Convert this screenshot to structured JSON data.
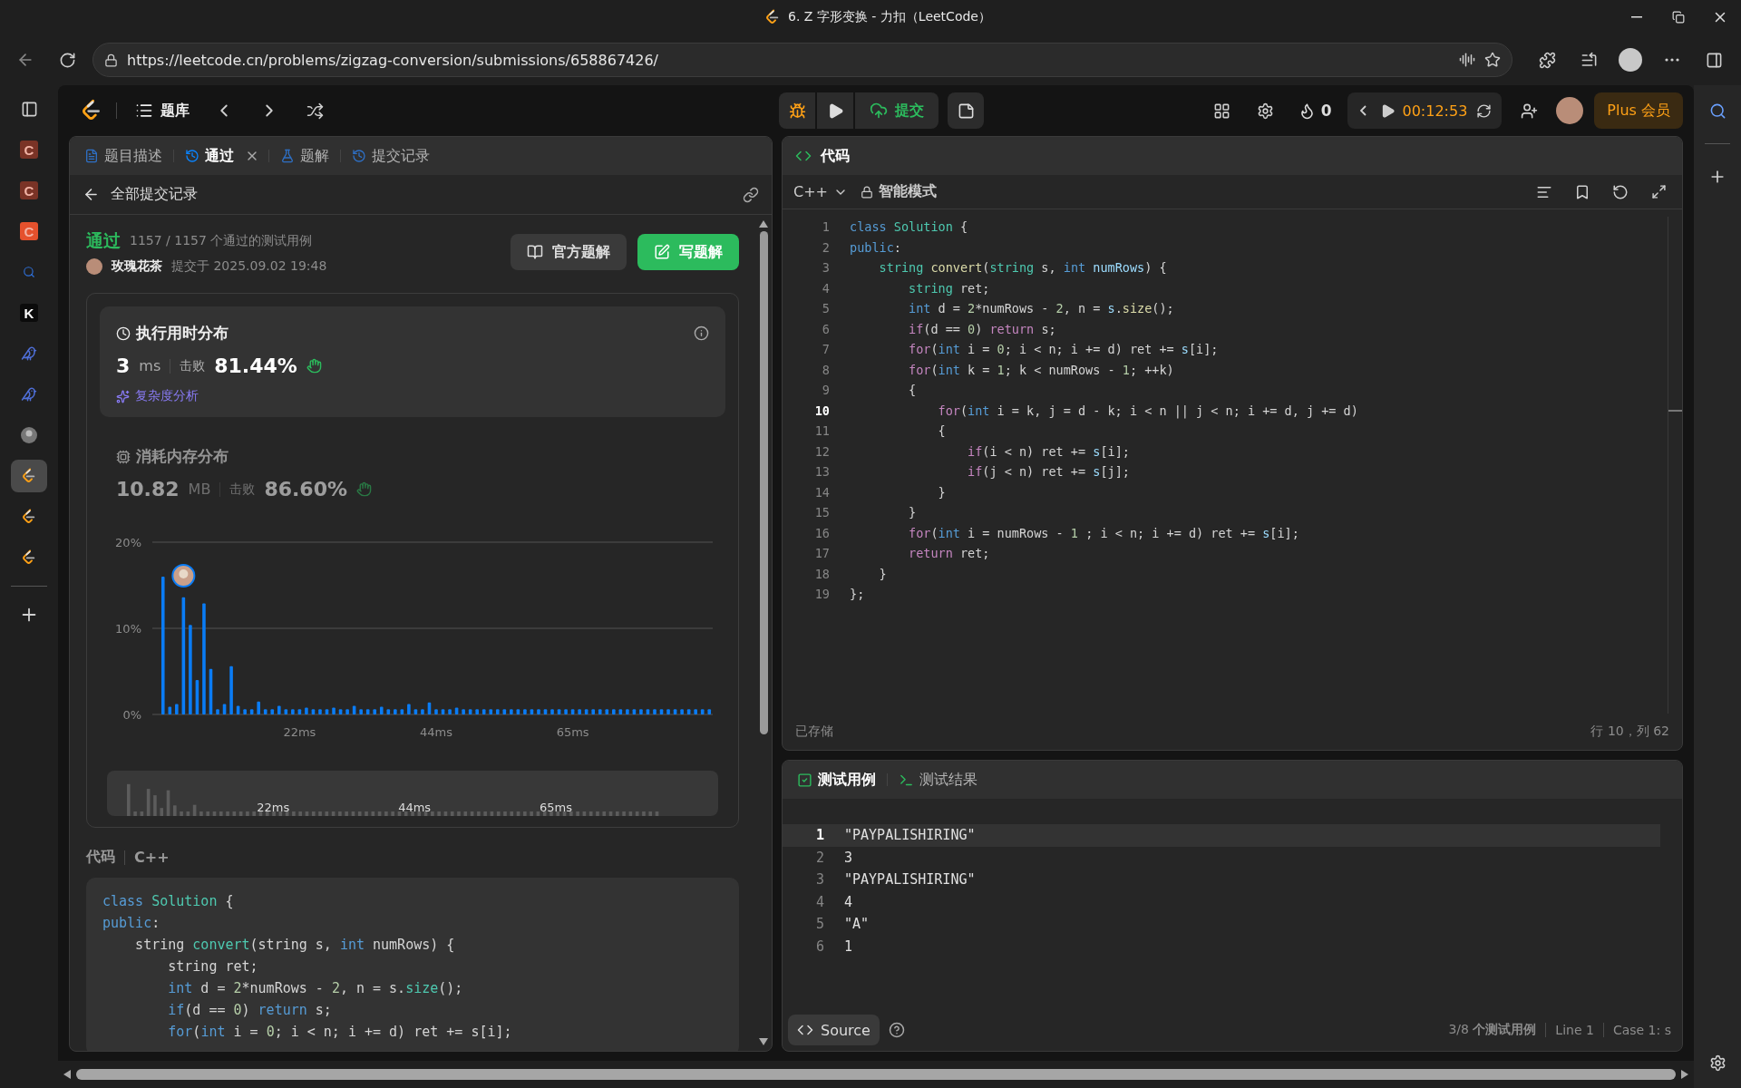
{
  "browser": {
    "title": "6. Z 字形变换 - 力扣（LeetCode）",
    "url": "https://leetcode.cn/problems/zigzag-conversion/submissions/658867426/"
  },
  "sidebar_tabs": [
    {
      "kind": "letter",
      "label": "C",
      "color": "#7a3326",
      "selected": false
    },
    {
      "kind": "letter",
      "label": "C",
      "color": "#7a3326",
      "selected": false
    },
    {
      "kind": "letter",
      "label": "C",
      "color": "#e5512d",
      "selected": false
    },
    {
      "kind": "search",
      "selected": false
    },
    {
      "kind": "letter",
      "label": "K",
      "color": "#0b0b0b",
      "selected": false
    },
    {
      "kind": "bird",
      "selected": false
    },
    {
      "kind": "bird",
      "selected": false
    },
    {
      "kind": "avatar",
      "selected": false
    },
    {
      "kind": "leetcode",
      "selected": true
    },
    {
      "kind": "leetcode",
      "selected": false
    },
    {
      "kind": "leetcode",
      "selected": false
    }
  ],
  "nav": {
    "library": "题库",
    "submit": "提交",
    "streak": "0",
    "timer": "00:12:53",
    "plus": "Plus 会员"
  },
  "left_tabs": [
    {
      "label": "题目描述",
      "kind": "description",
      "selected": false,
      "closable": false
    },
    {
      "label": "通过",
      "kind": "result",
      "selected": true,
      "closable": true
    },
    {
      "label": "题解",
      "kind": "solutions",
      "selected": false,
      "closable": false
    },
    {
      "label": "提交记录",
      "kind": "submissions",
      "selected": false,
      "closable": false
    }
  ],
  "submission": {
    "back": "全部提交记录",
    "status": "通过",
    "cases": "1157 / 1157 个通过的测试用例",
    "user": "玫瑰花茶",
    "submitted": "提交于 2025.09.02 19:48",
    "buttons": [
      {
        "kind": "solution",
        "label": "官方题解"
      },
      {
        "kind": "write",
        "label": "写题解"
      }
    ]
  },
  "stats": [
    {
      "kind": "time",
      "title": "执行用时分布",
      "value": "3",
      "unit": "ms",
      "beat_label": "击败",
      "beat": "81.44%",
      "selected": true,
      "link": "复杂度分析",
      "chart_data": {
        "type": "bar",
        "ylim": [
          0,
          20
        ],
        "yticks": [
          {
            "value": 0,
            "label": "0%"
          },
          {
            "value": 10,
            "label": "10%"
          },
          {
            "value": 20,
            "label": "20%"
          }
        ],
        "categories": [
          null,
          null,
          null,
          null,
          null,
          null,
          null,
          null,
          null,
          null,
          null,
          null,
          null,
          null,
          null,
          null,
          null,
          null,
          null,
          null,
          "22ms",
          null,
          null,
          null,
          null,
          null,
          null,
          null,
          null,
          null,
          null,
          null,
          null,
          null,
          null,
          null,
          null,
          null,
          null,
          null,
          "44ms",
          null,
          null,
          null,
          null,
          null,
          null,
          null,
          null,
          null,
          null,
          null,
          null,
          null,
          null,
          null,
          null,
          null,
          null,
          null,
          "65ms",
          null,
          null,
          null,
          null,
          null,
          null,
          null,
          null,
          null,
          null,
          null,
          null,
          null,
          null,
          null,
          null,
          null,
          null,
          null,
          null
        ],
        "series": [
          {
            "color": "#0a7cf5",
            "values": [
              16.0,
              0.9,
              1.2,
              13.6,
              10.4,
              4.0,
              12.9,
              5.3,
              0.6,
              1.2,
              5.6,
              1.0,
              0.6,
              0.6,
              1.5,
              0.6,
              0.6,
              1.0,
              0.6,
              0.6,
              0.6,
              0.8,
              0.6,
              0.6,
              0.6,
              0.8,
              0.6,
              0.6,
              1.0,
              0.6,
              0.6,
              0.6,
              0.9,
              0.6,
              0.6,
              0.6,
              1.2,
              0.6,
              0.6,
              1.4,
              0.6,
              0.6,
              0.6,
              0.8,
              0.6,
              0.6,
              0.6,
              0.6,
              0.6,
              0.6,
              0.6,
              0.6,
              0.6,
              0.6,
              0.6,
              0.6,
              0.6,
              0.6,
              0.6,
              0.6,
              0.6,
              0.6,
              0.6,
              0.6,
              0.6,
              0.6,
              0.6,
              0.6,
              0.6,
              0.6,
              0.6,
              0.6,
              0.6,
              0.6,
              0.6,
              0.6,
              0.6,
              0.6,
              0.6,
              0.6,
              0.6
            ]
          }
        ]
      },
      "overview_labels": [
        "22ms",
        "44ms",
        "65ms"
      ]
    },
    {
      "kind": "memory",
      "title": "消耗内存分布",
      "value": "10.82",
      "unit": "MB",
      "beat_label": "击败",
      "beat": "86.60%",
      "selected": false
    }
  ],
  "code_section": {
    "title": "代码",
    "language": "C++",
    "lines": [
      {
        "segments": [
          {
            "kind": "keyword",
            "text": "class "
          },
          {
            "kind": "type",
            "text": "Solution"
          },
          {
            "kind": "plain",
            "text": " {"
          }
        ]
      },
      {
        "segments": [
          {
            "kind": "keyword",
            "text": "public"
          },
          {
            "kind": "plain",
            "text": ":"
          }
        ]
      },
      {
        "segments": [
          {
            "kind": "plain",
            "text": "    string "
          },
          {
            "kind": "type",
            "text": "convert"
          },
          {
            "kind": "plain",
            "text": "(string s, "
          },
          {
            "kind": "keyword",
            "text": "int"
          },
          {
            "kind": "plain",
            "text": " numRows) {"
          }
        ]
      },
      {
        "segments": [
          {
            "kind": "plain",
            "text": "        string ret;"
          }
        ]
      },
      {
        "segments": [
          {
            "kind": "keyword",
            "text": "        int"
          },
          {
            "kind": "plain",
            "text": " d = "
          },
          {
            "kind": "number",
            "text": "2"
          },
          {
            "kind": "plain",
            "text": "*numRows - "
          },
          {
            "kind": "number",
            "text": "2"
          },
          {
            "kind": "plain",
            "text": ", n = s."
          },
          {
            "kind": "type",
            "text": "size"
          },
          {
            "kind": "plain",
            "text": "();"
          }
        ]
      },
      {
        "segments": [
          {
            "kind": "keyword",
            "text": "        if"
          },
          {
            "kind": "plain",
            "text": "(d == "
          },
          {
            "kind": "number",
            "text": "0"
          },
          {
            "kind": "plain",
            "text": ") "
          },
          {
            "kind": "keyword",
            "text": "return"
          },
          {
            "kind": "plain",
            "text": " s;"
          }
        ]
      },
      {
        "segments": [
          {
            "kind": "keyword",
            "text": "        for"
          },
          {
            "kind": "plain",
            "text": "("
          },
          {
            "kind": "keyword",
            "text": "int"
          },
          {
            "kind": "plain",
            "text": " i = "
          },
          {
            "kind": "number",
            "text": "0"
          },
          {
            "kind": "plain",
            "text": "; i < n; i += d) ret += s[i];"
          }
        ]
      }
    ]
  },
  "editor": {
    "title": "代码",
    "language": "C++",
    "mode": "智能模式",
    "saved": "已存储",
    "cursor": "行 10，列 62",
    "lines": [
      {
        "number": "1",
        "current": false,
        "segments": [
          {
            "kind": "keyword",
            "text": "class "
          },
          {
            "kind": "type",
            "text": "Solution"
          },
          {
            "kind": "plain",
            "text": " {"
          }
        ]
      },
      {
        "number": "2",
        "current": false,
        "segments": [
          {
            "kind": "keyword",
            "text": "public"
          },
          {
            "kind": "plain",
            "text": ":"
          }
        ]
      },
      {
        "number": "3",
        "current": false,
        "segments": [
          {
            "kind": "type",
            "text": "    string"
          },
          {
            "kind": "function",
            "text": " convert"
          },
          {
            "kind": "plain",
            "text": "("
          },
          {
            "kind": "type",
            "text": "string"
          },
          {
            "kind": "plain",
            "text": " s, "
          },
          {
            "kind": "keyword",
            "text": "int"
          },
          {
            "kind": "variable",
            "text": " numRows"
          },
          {
            "kind": "plain",
            "text": ") {"
          }
        ]
      },
      {
        "number": "4",
        "current": false,
        "segments": [
          {
            "kind": "type",
            "text": "        string"
          },
          {
            "kind": "plain",
            "text": " ret;"
          }
        ]
      },
      {
        "number": "5",
        "current": false,
        "segments": [
          {
            "kind": "keyword",
            "text": "        int"
          },
          {
            "kind": "plain",
            "text": " d = "
          },
          {
            "kind": "number",
            "text": "2"
          },
          {
            "kind": "plain",
            "text": "*numRows - "
          },
          {
            "kind": "number",
            "text": "2"
          },
          {
            "kind": "plain",
            "text": ", n = "
          },
          {
            "kind": "variable",
            "text": "s"
          },
          {
            "kind": "plain",
            "text": "."
          },
          {
            "kind": "function",
            "text": "size"
          },
          {
            "kind": "plain",
            "text": "();"
          }
        ]
      },
      {
        "number": "6",
        "current": false,
        "segments": [
          {
            "kind": "control",
            "text": "        if"
          },
          {
            "kind": "plain",
            "text": "(d == "
          },
          {
            "kind": "number",
            "text": "0"
          },
          {
            "kind": "plain",
            "text": ") "
          },
          {
            "kind": "control",
            "text": "return"
          },
          {
            "kind": "plain",
            "text": " s;"
          }
        ]
      },
      {
        "number": "7",
        "current": false,
        "segments": [
          {
            "kind": "control",
            "text": "        for"
          },
          {
            "kind": "plain",
            "text": "("
          },
          {
            "kind": "keyword",
            "text": "int"
          },
          {
            "kind": "plain",
            "text": " i = "
          },
          {
            "kind": "number",
            "text": "0"
          },
          {
            "kind": "plain",
            "text": "; i < n; i += d) ret += "
          },
          {
            "kind": "variable",
            "text": "s"
          },
          {
            "kind": "plain",
            "text": "[i];"
          }
        ]
      },
      {
        "number": "8",
        "current": false,
        "segments": [
          {
            "kind": "control",
            "text": "        for"
          },
          {
            "kind": "plain",
            "text": "("
          },
          {
            "kind": "keyword",
            "text": "int"
          },
          {
            "kind": "plain",
            "text": " k = "
          },
          {
            "kind": "number",
            "text": "1"
          },
          {
            "kind": "plain",
            "text": "; k < numRows - "
          },
          {
            "kind": "number",
            "text": "1"
          },
          {
            "kind": "plain",
            "text": "; ++k)"
          }
        ]
      },
      {
        "number": "9",
        "current": false,
        "segments": [
          {
            "kind": "plain",
            "text": "        {"
          }
        ]
      },
      {
        "number": "10",
        "current": true,
        "segments": [
          {
            "kind": "control",
            "text": "            for"
          },
          {
            "kind": "plain",
            "text": "("
          },
          {
            "kind": "keyword",
            "text": "int"
          },
          {
            "kind": "plain",
            "text": " i = k, j = d - k; i < n || j < n; i += d, j += d)"
          }
        ]
      },
      {
        "number": "11",
        "current": false,
        "segments": [
          {
            "kind": "plain",
            "text": "            {"
          }
        ]
      },
      {
        "number": "12",
        "current": false,
        "segments": [
          {
            "kind": "control",
            "text": "                if"
          },
          {
            "kind": "plain",
            "text": "(i < n) ret += "
          },
          {
            "kind": "variable",
            "text": "s"
          },
          {
            "kind": "plain",
            "text": "[i];"
          }
        ]
      },
      {
        "number": "13",
        "current": false,
        "segments": [
          {
            "kind": "control",
            "text": "                if"
          },
          {
            "kind": "plain",
            "text": "(j < n) ret += "
          },
          {
            "kind": "variable",
            "text": "s"
          },
          {
            "kind": "plain",
            "text": "[j];"
          }
        ]
      },
      {
        "number": "14",
        "current": false,
        "segments": [
          {
            "kind": "plain",
            "text": "            }"
          }
        ]
      },
      {
        "number": "15",
        "current": false,
        "segments": [
          {
            "kind": "plain",
            "text": "        }"
          }
        ]
      },
      {
        "number": "16",
        "current": false,
        "segments": [
          {
            "kind": "control",
            "text": "        for"
          },
          {
            "kind": "plain",
            "text": "("
          },
          {
            "kind": "keyword",
            "text": "int"
          },
          {
            "kind": "plain",
            "text": " i = numRows - "
          },
          {
            "kind": "number",
            "text": "1"
          },
          {
            "kind": "plain",
            "text": " ; i < n; i += d) ret += "
          },
          {
            "kind": "variable",
            "text": "s"
          },
          {
            "kind": "plain",
            "text": "[i];"
          }
        ]
      },
      {
        "number": "17",
        "current": false,
        "segments": [
          {
            "kind": "control",
            "text": "        return"
          },
          {
            "kind": "plain",
            "text": " ret;"
          }
        ]
      },
      {
        "number": "18",
        "current": false,
        "segments": [
          {
            "kind": "plain",
            "text": "    }"
          }
        ]
      },
      {
        "number": "19",
        "current": false,
        "segments": [
          {
            "kind": "plain",
            "text": "};"
          }
        ]
      }
    ]
  },
  "tests": {
    "tabs": [
      {
        "label": "测试用例",
        "kind": "cases",
        "selected": true
      },
      {
        "label": "测试结果",
        "kind": "results",
        "selected": false
      }
    ],
    "lines": [
      {
        "number": "1",
        "text": "\"PAYPALISHIRING\"",
        "current": true
      },
      {
        "number": "2",
        "text": "3",
        "current": false
      },
      {
        "number": "3",
        "text": "\"PAYPALISHIRING\"",
        "current": false
      },
      {
        "number": "4",
        "text": "4",
        "current": false
      },
      {
        "number": "5",
        "text": "\"A\"",
        "current": false
      },
      {
        "number": "6",
        "text": "1",
        "current": false
      }
    ],
    "source": "Source",
    "status": [
      "3/8 **个测试用例**",
      "Line 1",
      "Case 1: s"
    ]
  }
}
